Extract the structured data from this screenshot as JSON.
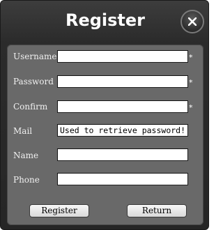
{
  "dialog": {
    "title": "Register",
    "close_icon": "close-icon"
  },
  "form": {
    "fields": [
      {
        "label": "Username",
        "value": "",
        "required_mark": "*"
      },
      {
        "label": "Password",
        "value": "",
        "required_mark": "*"
      },
      {
        "label": "Confirm",
        "value": "",
        "required_mark": "*"
      },
      {
        "label": "Mail",
        "value": "Used to retrieve password!",
        "required_mark": ""
      },
      {
        "label": "Name",
        "value": "",
        "required_mark": ""
      },
      {
        "label": "Phone",
        "value": "",
        "required_mark": ""
      }
    ]
  },
  "buttons": {
    "register_label": "Register",
    "return_label": "Return"
  },
  "colors": {
    "dialog_background": "#2b2b2b",
    "panel_background": "#696969",
    "title_text": "#ffffff"
  }
}
